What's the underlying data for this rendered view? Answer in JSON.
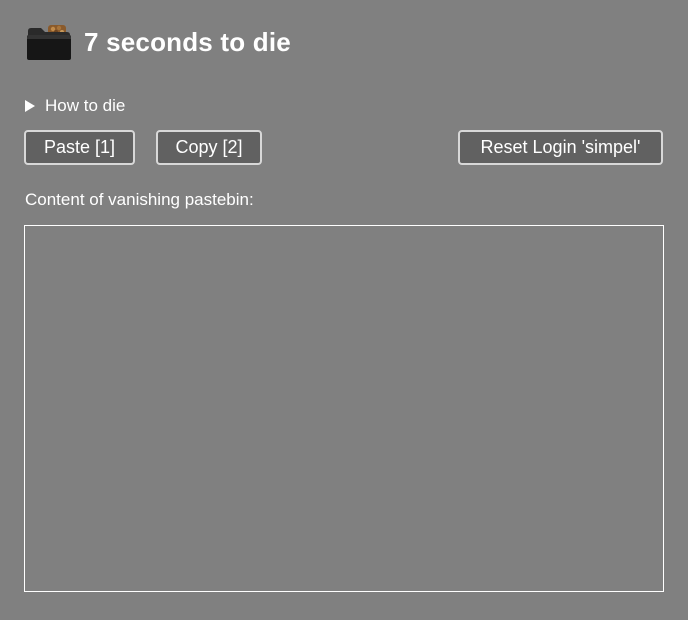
{
  "header": {
    "icon": "folder-icon",
    "title": "7 seconds to die"
  },
  "details": {
    "summary": "How to die"
  },
  "toolbar": {
    "paste_label": "Paste [1]",
    "copy_label": "Copy [2]",
    "reset_label": "Reset Login 'simpel'"
  },
  "pastebin": {
    "label": "Content of vanishing pastebin:",
    "value": ""
  },
  "colors": {
    "background": "#808080",
    "button_bg": "#616161",
    "button_border": "#d8d8d8",
    "text": "#ffffff"
  }
}
